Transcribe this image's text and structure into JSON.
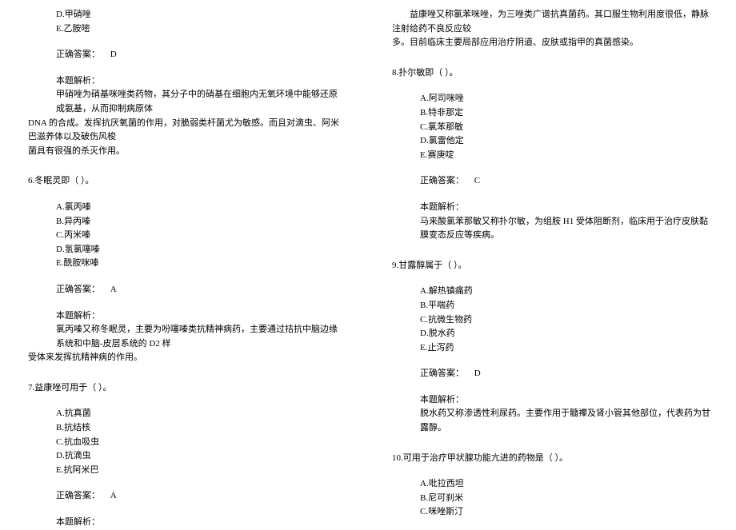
{
  "leftCol": {
    "q5_cont": {
      "opts": [
        "D.甲硝唑",
        "E.乙胺嘧"
      ],
      "answerLabel": "正确答案：",
      "answerValue": "D",
      "expTitle": "本题解析：",
      "expLine1": "甲硝唑为硝基咪唑类药物，其分子中的硝基在细胞内无氧环境中能够还原成氨基，从而抑制病原体",
      "expLine2": "DNA 的合成。发挥抗厌氧菌的作用，对脆弱类杆菌尤为敏感。而且对滴虫、阿米巴滋养体以及破伤风梭",
      "expLine3": "菌具有很强的杀灭作用。"
    },
    "q6": {
      "question": "6.冬眠灵即（  ）。",
      "opts": [
        "A.氯丙嗪",
        "B.异丙嗪",
        "C.丙米嗪",
        "D.氢氯噻嗪",
        "E.酰胺咪嗪"
      ],
      "answerLabel": "正确答案：",
      "answerValue": "A",
      "expTitle": "本题解析：",
      "expLine1": "氯丙嗪又称冬眠灵，主要为吩噻嗪类抗精神病药，主要通过拮抗中脑边缘系统和中脑-皮层系统的 D2 样",
      "expLine2": "受体来发挥抗精神病的作用。"
    },
    "q7": {
      "question": "7.益康唑可用于（  ）。",
      "opts": [
        "A.抗真菌",
        "B.抗结核",
        "C.抗血吸虫",
        "D.抗滴虫",
        "E.抗阿米巴"
      ],
      "answerLabel": "正确答案：",
      "answerValue": "A",
      "expTitle": "本题解析："
    }
  },
  "rightCol": {
    "q7_cont": {
      "expLine1": "益康唑又称氯苯咪唑，为三唑类广谱抗真菌药。其口服生物利用度很低，静脉注射给药不良反应较",
      "expLine2": "多。目前临床主要局部应用治疗阴道、皮肤或指甲的真菌感染。"
    },
    "q8": {
      "question": "8.扑尔敏即（  ）。",
      "opts": [
        "A.阿司咪唑",
        "B.特非那定",
        "C.氯苯那敏",
        "D.氯雷他定",
        "E.赛庚啶"
      ],
      "answerLabel": "正确答案：",
      "answerValue": "C",
      "expTitle": "本题解析：",
      "expLine1": "马来酸氯苯那敏又称扑尔敏，为组胺 H1 受体阻断剂，临床用于治疗皮肤黏膜变态反应等疾病。"
    },
    "q9": {
      "question": "9.甘露醇属于（  ）。",
      "opts": [
        "A.解热镇痛药",
        "B.平喘药",
        "C.抗微生物药",
        "D.脱水药",
        "E.止泻药"
      ],
      "answerLabel": "正确答案：",
      "answerValue": "D",
      "expTitle": "本题解析：",
      "expLine1": "脱水药又称渗透性利尿药。主要作用于髓襻及肾小管其他部位，代表药为甘露醇。"
    },
    "q10": {
      "question": "10.可用于治疗甲状腺功能亢进的药物是（  ）。",
      "opts": [
        "A.吡拉西坦",
        "B.尼可刹米",
        "C.咪唑斯汀"
      ]
    }
  }
}
